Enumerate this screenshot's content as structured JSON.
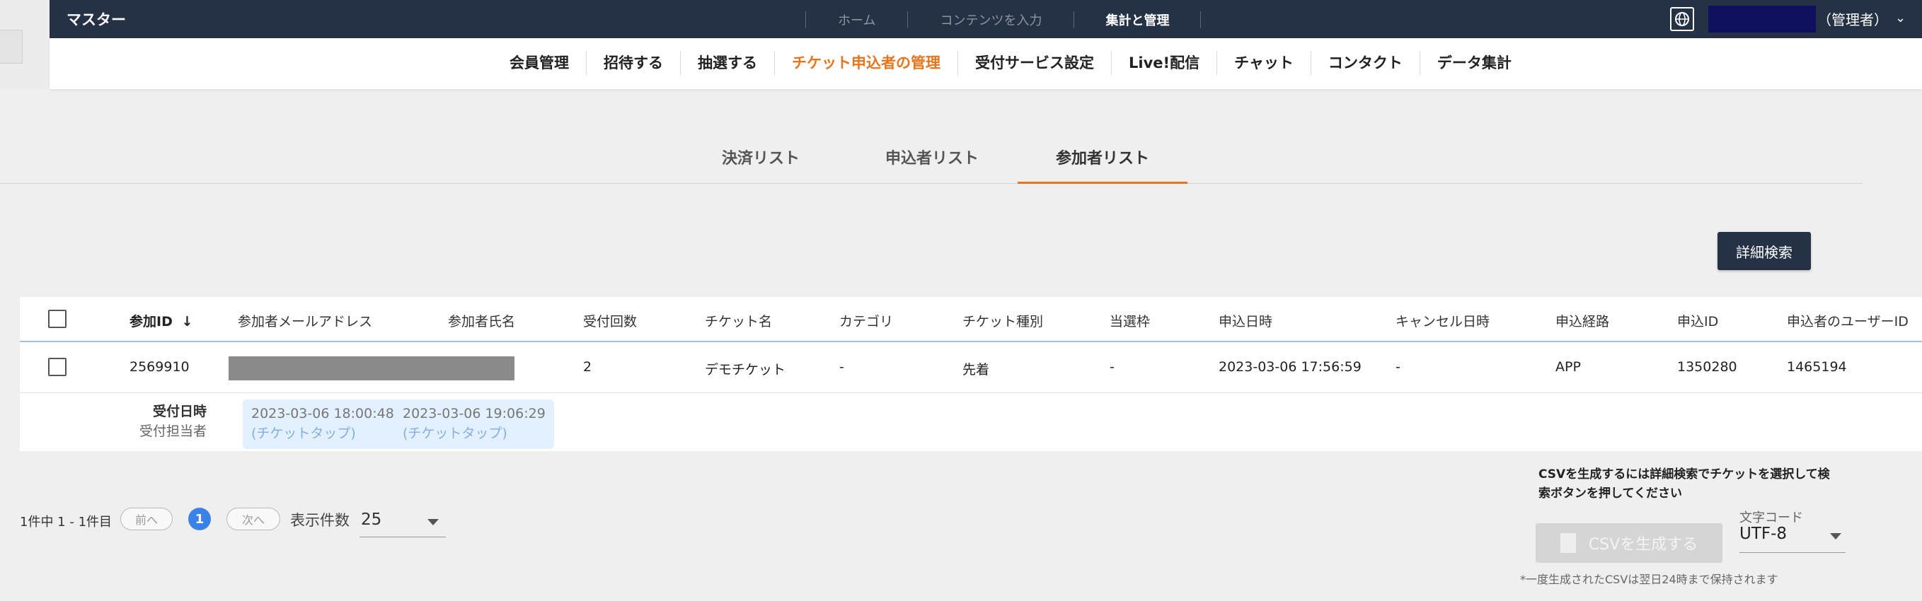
{
  "topbar": {
    "brand": "マスター",
    "nav": [
      "ホーム",
      "コンテンツを入力",
      "集計と管理"
    ],
    "active_index": 2,
    "user_role": "（管理者）",
    "user_caret": "⌄"
  },
  "mainnav": {
    "items": [
      "会員管理",
      "招待する",
      "抽選する",
      "チケット申込者の管理",
      "受付サービス設定",
      "Live!配信",
      "チャット",
      "コンタクト",
      "データ集計"
    ],
    "active_index": 3
  },
  "subtabs": {
    "items": [
      "決済リスト",
      "申込者リスト",
      "参加者リスト"
    ],
    "active_index": 2
  },
  "detail_search_button": "詳細検索",
  "table": {
    "headers": {
      "id": "参加ID",
      "sort_arrow": "↓",
      "email": "参加者メールアドレス",
      "name": "参加者氏名",
      "count": "受付回数",
      "ticket": "チケット名",
      "category": "カテゴリ",
      "type": "チケット種別",
      "quota": "当選枠",
      "applied_at": "申込日時",
      "canceled_at": "キャンセル日時",
      "route": "申込経路",
      "apply_id": "申込ID",
      "user_id": "申込者のユーザーID"
    },
    "row": {
      "id": "2569910",
      "count": "2",
      "ticket": "デモチケット",
      "category": "-",
      "type": "先着",
      "quota": "-",
      "applied_at": "2023-03-06 17:56:59",
      "canceled_at": "-",
      "route": "APP",
      "apply_id": "1350280",
      "user_id": "1465194"
    },
    "reception": {
      "label_time": "受付日時",
      "label_staff": "受付担当者",
      "entries": [
        {
          "time": "2023-03-06 18:00:48",
          "via": "(チケットタップ)"
        },
        {
          "time": "2023-03-06 19:06:29",
          "via": "(チケットタップ)"
        }
      ]
    }
  },
  "pager": {
    "summary": "1件中 1 - 1件目",
    "prev": "前へ",
    "page": "1",
    "next": "次へ",
    "per_page_label": "表示件数",
    "per_page_value": "25"
  },
  "csv": {
    "note": "CSVを生成するには詳細検索でチケットを選択して検索ボタンを押してください",
    "button": "CSVを生成する",
    "encoding_label": "文字コード",
    "encoding_value": "UTF-8",
    "footnote": "*一度生成されたCSVは翌日24時まで保持されます"
  }
}
